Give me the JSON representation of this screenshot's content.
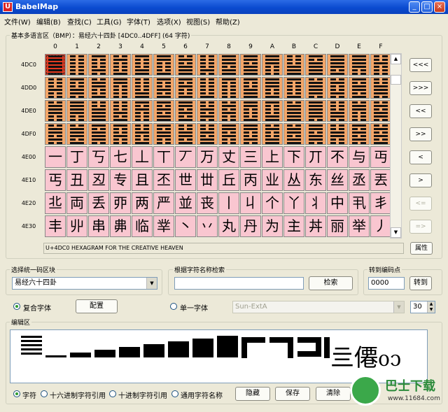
{
  "window": {
    "title": "BabelMap",
    "icon_letter": "U",
    "minimize": "_",
    "maximize": "□",
    "close": "×"
  },
  "menu": [
    "文件(W)",
    "编辑(B)",
    "查找(C)",
    "工具(G)",
    "字体(T)",
    "选项(X)",
    "视图(S)",
    "帮助(Z)"
  ],
  "grid": {
    "header": "基本多语言区（BMP）：易经六十四卦 [4DC0..4DFF] (64 字符)",
    "columns": [
      "0",
      "1",
      "2",
      "3",
      "4",
      "5",
      "6",
      "7",
      "8",
      "9",
      "A",
      "B",
      "C",
      "D",
      "E",
      "F"
    ],
    "rows": [
      {
        "label": "4DC0",
        "type": "hexagram",
        "cells": [
          "111111",
          "000000",
          "100010",
          "010001",
          "100011",
          "110001",
          "010111",
          "000010",
          "111011",
          "110111",
          "111000",
          "000111",
          "101111",
          "111101",
          "111100",
          "001000"
        ]
      },
      {
        "label": "4DD0",
        "type": "hexagram",
        "cells": [
          "000100",
          "100110",
          "011001",
          "110000",
          "000011",
          "100101",
          "101001",
          "000001",
          "100000",
          "100111",
          "111001",
          "100001",
          "011110",
          "010010",
          "101101",
          "001110"
        ]
      },
      {
        "label": "4DE0",
        "type": "hexagram",
        "cells": [
          "011100",
          "111100",
          "001111",
          "000101",
          "101000",
          "101011",
          "110101",
          "001010",
          "010100",
          "110001",
          "100011",
          "011111",
          "111110",
          "000110",
          "011000",
          "010110"
        ]
      },
      {
        "label": "4DF0",
        "type": "hexagram",
        "cells": [
          "011010",
          "011101",
          "101110",
          "100100",
          "001001",
          "101100",
          "001101",
          "001011",
          "110100",
          "110010",
          "010011",
          "011011",
          "110110",
          "001100",
          "101010",
          "010101"
        ]
      },
      {
        "label": "4E00",
        "type": "cjk",
        "cells": [
          "一",
          "丁",
          "丂",
          "七",
          "丄",
          "丅",
          "丆",
          "万",
          "丈",
          "三",
          "上",
          "下",
          "丌",
          "不",
          "与",
          "丏"
        ]
      },
      {
        "label": "4E10",
        "type": "cjk",
        "cells": [
          "丐",
          "丑",
          "丒",
          "专",
          "且",
          "丕",
          "世",
          "丗",
          "丘",
          "丙",
          "业",
          "丛",
          "东",
          "丝",
          "丞",
          "丟"
        ]
      },
      {
        "label": "4E20",
        "type": "cjk",
        "cells": [
          "丠",
          "両",
          "丢",
          "丣",
          "两",
          "严",
          "並",
          "丧",
          "丨",
          "丩",
          "个",
          "丫",
          "丬",
          "中",
          "丮",
          "丯"
        ]
      },
      {
        "label": "4E30",
        "type": "cjk",
        "cells": [
          "丰",
          "丱",
          "串",
          "丳",
          "临",
          "丵",
          "丶",
          "丷",
          "丸",
          "丹",
          "为",
          "主",
          "丼",
          "丽",
          "举",
          "丿"
        ]
      }
    ],
    "selected": {
      "row": 0,
      "col": 0
    },
    "description": "U+4DC0 HEXAGRAM FOR THE CREATIVE HEAVEN",
    "property_button": "属性"
  },
  "nav_buttons": [
    {
      "label": "<<<",
      "enabled": true
    },
    {
      "label": ">>>",
      "enabled": true
    },
    {
      "label": "<<",
      "enabled": true
    },
    {
      "label": ">>",
      "enabled": true
    },
    {
      "label": "<",
      "enabled": true
    },
    {
      "label": ">",
      "enabled": true
    },
    {
      "label": "<=",
      "enabled": false
    },
    {
      "label": "=>",
      "enabled": false
    }
  ],
  "block_select": {
    "label": "选择统一码区块",
    "value": "易经六十四卦"
  },
  "name_search": {
    "label": "根据字符名称检索",
    "value": "",
    "button": "检索"
  },
  "goto": {
    "label": "转到编码点",
    "value": "0000",
    "button": "转到"
  },
  "font": {
    "composite_label": "复合字体",
    "composite_selected": true,
    "config_button": "配置",
    "single_label": "单一字体",
    "single_value": "Sun-ExtA",
    "size": "30"
  },
  "edit": {
    "label": "编辑区",
    "text": "亖僊᧐᧑",
    "options": [
      {
        "label": "字符",
        "selected": true
      },
      {
        "label": "十六进制字符引用",
        "selected": false
      },
      {
        "label": "十进制字符引用",
        "selected": false
      },
      {
        "label": "通用字符名称",
        "selected": false
      }
    ],
    "hide_button": "隐藏",
    "save_button": "保存",
    "clear_button": "清除"
  },
  "watermark": {
    "text": "巴士下载",
    "url": "www.11684.com"
  }
}
